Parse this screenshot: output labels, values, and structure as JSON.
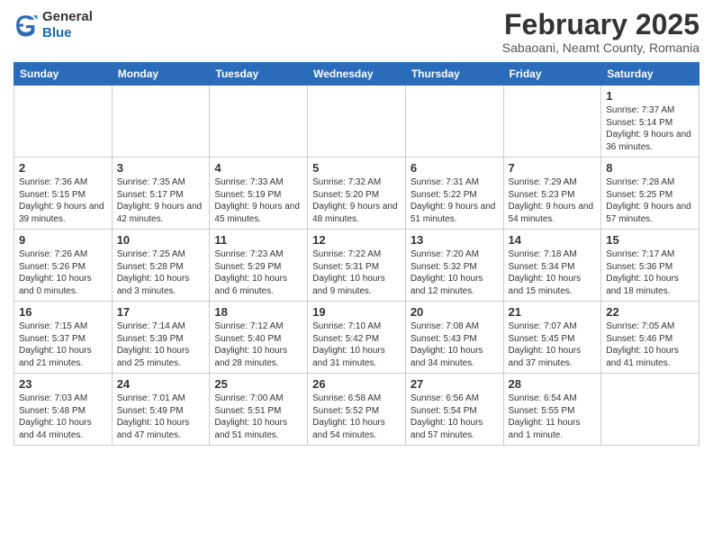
{
  "header": {
    "logo_general": "General",
    "logo_blue": "Blue",
    "month_title": "February 2025",
    "subtitle": "Sabaoani, Neamt County, Romania"
  },
  "calendar": {
    "days_of_week": [
      "Sunday",
      "Monday",
      "Tuesday",
      "Wednesday",
      "Thursday",
      "Friday",
      "Saturday"
    ],
    "weeks": [
      [
        {
          "day": null,
          "info": null
        },
        {
          "day": null,
          "info": null
        },
        {
          "day": null,
          "info": null
        },
        {
          "day": null,
          "info": null
        },
        {
          "day": null,
          "info": null
        },
        {
          "day": null,
          "info": null
        },
        {
          "day": "1",
          "info": "Sunrise: 7:37 AM\nSunset: 5:14 PM\nDaylight: 9 hours and 36 minutes."
        }
      ],
      [
        {
          "day": "2",
          "info": "Sunrise: 7:36 AM\nSunset: 5:15 PM\nDaylight: 9 hours and 39 minutes."
        },
        {
          "day": "3",
          "info": "Sunrise: 7:35 AM\nSunset: 5:17 PM\nDaylight: 9 hours and 42 minutes."
        },
        {
          "day": "4",
          "info": "Sunrise: 7:33 AM\nSunset: 5:19 PM\nDaylight: 9 hours and 45 minutes."
        },
        {
          "day": "5",
          "info": "Sunrise: 7:32 AM\nSunset: 5:20 PM\nDaylight: 9 hours and 48 minutes."
        },
        {
          "day": "6",
          "info": "Sunrise: 7:31 AM\nSunset: 5:22 PM\nDaylight: 9 hours and 51 minutes."
        },
        {
          "day": "7",
          "info": "Sunrise: 7:29 AM\nSunset: 5:23 PM\nDaylight: 9 hours and 54 minutes."
        },
        {
          "day": "8",
          "info": "Sunrise: 7:28 AM\nSunset: 5:25 PM\nDaylight: 9 hours and 57 minutes."
        }
      ],
      [
        {
          "day": "9",
          "info": "Sunrise: 7:26 AM\nSunset: 5:26 PM\nDaylight: 10 hours and 0 minutes."
        },
        {
          "day": "10",
          "info": "Sunrise: 7:25 AM\nSunset: 5:28 PM\nDaylight: 10 hours and 3 minutes."
        },
        {
          "day": "11",
          "info": "Sunrise: 7:23 AM\nSunset: 5:29 PM\nDaylight: 10 hours and 6 minutes."
        },
        {
          "day": "12",
          "info": "Sunrise: 7:22 AM\nSunset: 5:31 PM\nDaylight: 10 hours and 9 minutes."
        },
        {
          "day": "13",
          "info": "Sunrise: 7:20 AM\nSunset: 5:32 PM\nDaylight: 10 hours and 12 minutes."
        },
        {
          "day": "14",
          "info": "Sunrise: 7:18 AM\nSunset: 5:34 PM\nDaylight: 10 hours and 15 minutes."
        },
        {
          "day": "15",
          "info": "Sunrise: 7:17 AM\nSunset: 5:36 PM\nDaylight: 10 hours and 18 minutes."
        }
      ],
      [
        {
          "day": "16",
          "info": "Sunrise: 7:15 AM\nSunset: 5:37 PM\nDaylight: 10 hours and 21 minutes."
        },
        {
          "day": "17",
          "info": "Sunrise: 7:14 AM\nSunset: 5:39 PM\nDaylight: 10 hours and 25 minutes."
        },
        {
          "day": "18",
          "info": "Sunrise: 7:12 AM\nSunset: 5:40 PM\nDaylight: 10 hours and 28 minutes."
        },
        {
          "day": "19",
          "info": "Sunrise: 7:10 AM\nSunset: 5:42 PM\nDaylight: 10 hours and 31 minutes."
        },
        {
          "day": "20",
          "info": "Sunrise: 7:08 AM\nSunset: 5:43 PM\nDaylight: 10 hours and 34 minutes."
        },
        {
          "day": "21",
          "info": "Sunrise: 7:07 AM\nSunset: 5:45 PM\nDaylight: 10 hours and 37 minutes."
        },
        {
          "day": "22",
          "info": "Sunrise: 7:05 AM\nSunset: 5:46 PM\nDaylight: 10 hours and 41 minutes."
        }
      ],
      [
        {
          "day": "23",
          "info": "Sunrise: 7:03 AM\nSunset: 5:48 PM\nDaylight: 10 hours and 44 minutes."
        },
        {
          "day": "24",
          "info": "Sunrise: 7:01 AM\nSunset: 5:49 PM\nDaylight: 10 hours and 47 minutes."
        },
        {
          "day": "25",
          "info": "Sunrise: 7:00 AM\nSunset: 5:51 PM\nDaylight: 10 hours and 51 minutes."
        },
        {
          "day": "26",
          "info": "Sunrise: 6:58 AM\nSunset: 5:52 PM\nDaylight: 10 hours and 54 minutes."
        },
        {
          "day": "27",
          "info": "Sunrise: 6:56 AM\nSunset: 5:54 PM\nDaylight: 10 hours and 57 minutes."
        },
        {
          "day": "28",
          "info": "Sunrise: 6:54 AM\nSunset: 5:55 PM\nDaylight: 11 hours and 1 minute."
        },
        {
          "day": null,
          "info": null
        }
      ]
    ]
  }
}
